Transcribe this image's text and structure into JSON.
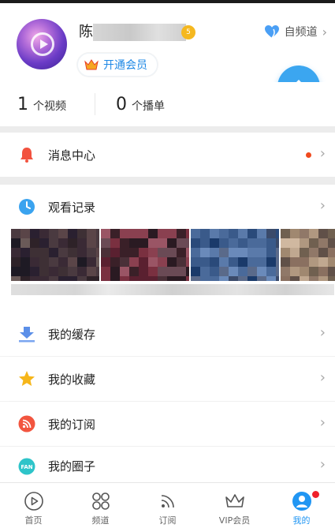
{
  "profile": {
    "username": "陈",
    "level": "5",
    "vip_label": "开通会员",
    "channel_label": "自频道"
  },
  "stats": [
    {
      "count": "1",
      "unit": "个视频"
    },
    {
      "count": "0",
      "unit": "个播单"
    }
  ],
  "menu": {
    "messages": "消息中心",
    "history": "观看记录",
    "cache": "我的缓存",
    "favorites": "我的收藏",
    "subscriptions": "我的订阅",
    "circles": "我的圈子"
  },
  "nav": {
    "items": [
      {
        "label": "首页"
      },
      {
        "label": "频道"
      },
      {
        "label": "订阅"
      },
      {
        "label": "VIP会员"
      },
      {
        "label": "我的"
      }
    ]
  },
  "colors": {
    "accent": "#2196f3",
    "notification": "#f04a1e"
  }
}
